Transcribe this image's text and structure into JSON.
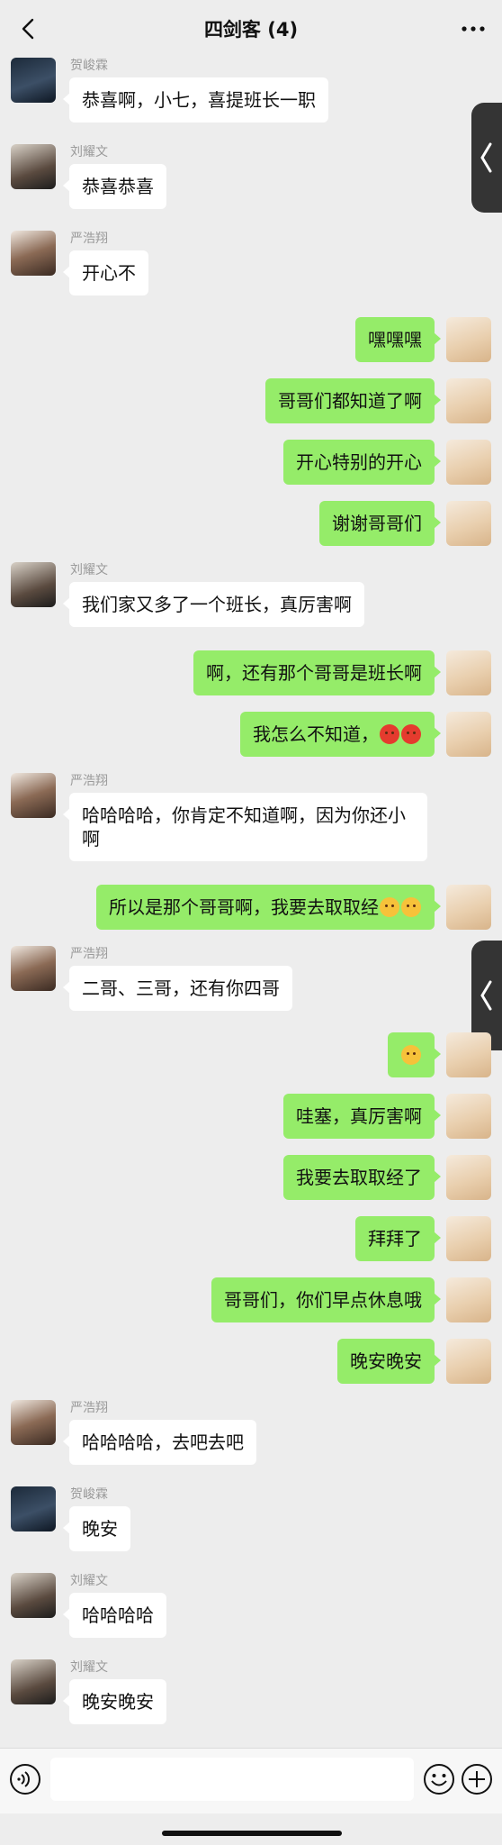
{
  "nav": {
    "title": "四剑客 (4)"
  },
  "colors": {
    "self_bubble": "#95ec69",
    "other_bubble": "#ffffff",
    "background": "#ededed"
  },
  "messages": [
    {
      "side": "left",
      "sender": "贺峻霖",
      "avatar": "avatar-hejunlin",
      "text": "恭喜啊，小七，喜提班长一职"
    },
    {
      "side": "left",
      "sender": "刘耀文",
      "avatar": "avatar-liuyaowen",
      "text": "恭喜恭喜"
    },
    {
      "side": "left",
      "sender": "严浩翔",
      "avatar": "avatar-yanhaoxiang",
      "text": "开心不"
    },
    {
      "side": "right",
      "avatar": "avatar-self",
      "text": "嘿嘿嘿"
    },
    {
      "side": "right",
      "avatar": "avatar-self",
      "text": "哥哥们都知道了啊"
    },
    {
      "side": "right",
      "avatar": "avatar-self",
      "text": "开心特别的开心"
    },
    {
      "side": "right",
      "avatar": "avatar-self",
      "text": "谢谢哥哥们"
    },
    {
      "side": "left",
      "sender": "刘耀文",
      "avatar": "avatar-liuyaowen",
      "text": "我们家又多了一个班长，真厉害啊"
    },
    {
      "side": "right",
      "avatar": "avatar-self",
      "text": "啊，还有那个哥哥是班长啊"
    },
    {
      "side": "right",
      "avatar": "avatar-self",
      "text": "我怎么不知道，",
      "emoji": "angry-face-icon",
      "emoji_count": 2
    },
    {
      "side": "left",
      "sender": "严浩翔",
      "avatar": "avatar-yanhaoxiang",
      "text": "哈哈哈哈，你肯定不知道啊，因为你还小啊"
    },
    {
      "side": "right",
      "avatar": "avatar-self",
      "text": "所以是那个哥哥啊，我要去取取经",
      "emoji": "giggle-face-icon",
      "emoji_count": 2
    },
    {
      "side": "left",
      "sender": "严浩翔",
      "avatar": "avatar-yanhaoxiang",
      "text": "二哥、三哥，还有你四哥"
    },
    {
      "side": "right",
      "avatar": "avatar-self",
      "text": "",
      "emoji": "worried-face-icon",
      "emoji_count": 1
    },
    {
      "side": "right",
      "avatar": "avatar-self",
      "text": "哇塞，真厉害啊"
    },
    {
      "side": "right",
      "avatar": "avatar-self",
      "text": "我要去取取经了"
    },
    {
      "side": "right",
      "avatar": "avatar-self",
      "text": "拜拜了"
    },
    {
      "side": "right",
      "avatar": "avatar-self",
      "text": "哥哥们，你们早点休息哦"
    },
    {
      "side": "right",
      "avatar": "avatar-self",
      "text": "晚安晚安"
    },
    {
      "side": "left",
      "sender": "严浩翔",
      "avatar": "avatar-yanhaoxiang",
      "text": "哈哈哈哈，去吧去吧"
    },
    {
      "side": "left",
      "sender": "贺峻霖",
      "avatar": "avatar-hejunlin",
      "text": "晚安"
    },
    {
      "side": "left",
      "sender": "刘耀文",
      "avatar": "avatar-liuyaowen",
      "text": "哈哈哈哈"
    },
    {
      "side": "left",
      "sender": "刘耀文",
      "avatar": "avatar-liuyaowen",
      "text": "晚安晚安"
    }
  ],
  "input": {
    "value": ""
  }
}
